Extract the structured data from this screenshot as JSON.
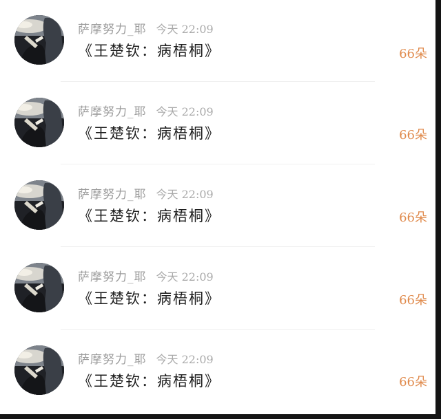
{
  "feed": {
    "items": [
      {
        "username": "萨摩努力_耶",
        "time": "今天 22:09",
        "title": "《王楚钦：病梧桐》",
        "count": "66朵"
      },
      {
        "username": "萨摩努力_耶",
        "time": "今天 22:09",
        "title": "《王楚钦：病梧桐》",
        "count": "66朵"
      },
      {
        "username": "萨摩努力_耶",
        "time": "今天 22:09",
        "title": "《王楚钦：病梧桐》",
        "count": "66朵"
      },
      {
        "username": "萨摩努力_耶",
        "time": "今天 22:09",
        "title": "《王楚钦：病梧桐》",
        "count": "66朵"
      },
      {
        "username": "萨摩努力_耶",
        "time": "今天 22:09",
        "title": "《王楚钦：病梧桐》",
        "count": "66朵"
      }
    ]
  },
  "colors": {
    "username": "#9c9c9c",
    "time": "#a9a9a9",
    "title": "#1e1e1e",
    "count": "#e08a4c",
    "divider": "#efefef"
  }
}
